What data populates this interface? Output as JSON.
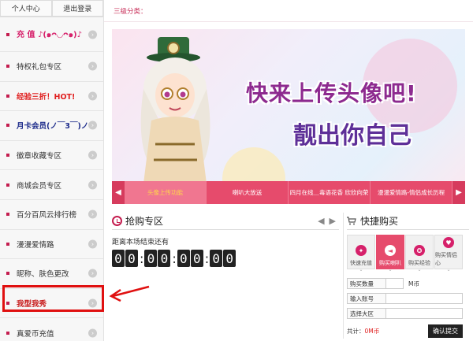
{
  "sidebar": {
    "top_links": [
      {
        "label": "个人中心"
      },
      {
        "label": "退出登录"
      }
    ],
    "items": [
      {
        "label": "充 值 ♪(๑ᴖ◡ᴖ๑)♪",
        "style": "pink"
      },
      {
        "label": "特权礼包专区",
        "style": "normal"
      },
      {
        "label": "经验三折！HOT!",
        "style": "red"
      },
      {
        "label": "月卡会员(ノ￣3￣)ノ",
        "style": "navy"
      },
      {
        "label": "徽章收藏专区",
        "style": "normal"
      },
      {
        "label": "商城会员专区",
        "style": "normal"
      },
      {
        "label": "百分百风云排行榜",
        "style": "normal"
      },
      {
        "label": "漫漫爱情路",
        "style": "normal"
      },
      {
        "label": "昵称、肤色更改",
        "style": "normal"
      },
      {
        "label": "我型我秀",
        "style": "darkred"
      },
      {
        "label": "真爱币充值",
        "style": "normal"
      }
    ]
  },
  "main": {
    "category_label": "三级分类：",
    "banner": {
      "headline1": "快来上传头像吧!",
      "headline2": "靓出你自己",
      "tabs": [
        {
          "label": "头像上传功能",
          "active": true
        },
        {
          "label": "喇叭大放送",
          "active": false
        },
        {
          "label": "四月在线＿毒语花香 欣欣向荣",
          "active": false
        },
        {
          "label": "漫漫爱情路-情侣成长历程",
          "active": false
        }
      ]
    },
    "flash_sale": {
      "title": "抢购专区",
      "countdown_label": "距离本场结束还有",
      "countdown": {
        "h": "00",
        "m": "00",
        "s": "00",
        "f": "00"
      }
    },
    "quick_buy": {
      "title": "快捷购买",
      "tabs": [
        {
          "label": "快速充值",
          "icon": "gift-icon",
          "active": false
        },
        {
          "label": "购买喇叭",
          "icon": "megaphone-icon",
          "active": true
        },
        {
          "label": "购买经验",
          "icon": "medal-icon",
          "active": false
        },
        {
          "label": "购买情侣心",
          "icon": "heart-icon",
          "active": false
        }
      ],
      "fields": [
        {
          "label": "购买数量",
          "unit": "M币"
        },
        {
          "label": "输入账号",
          "unit": ""
        },
        {
          "label": "选择大区",
          "unit": ""
        }
      ],
      "total_label": "共计：",
      "total_value": "0M币",
      "submit_label": "确认提交"
    }
  },
  "colors": {
    "accent": "#e64b6c",
    "highlight_border": "#e01010"
  }
}
